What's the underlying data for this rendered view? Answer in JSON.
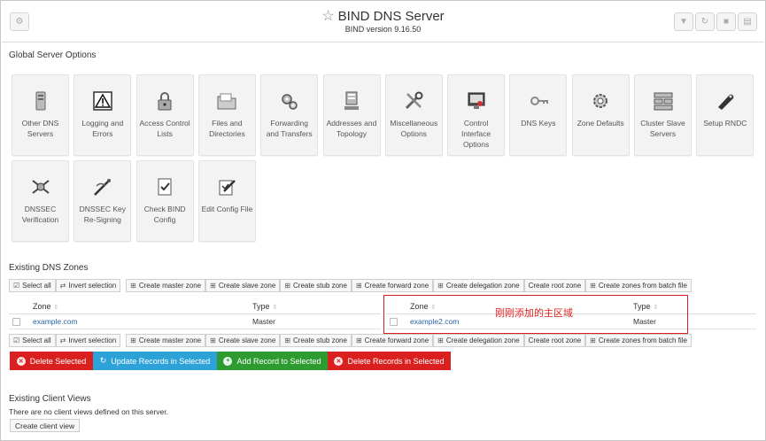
{
  "header": {
    "title": "BIND DNS Server",
    "subtitle": "BIND version 9.16.50",
    "icons": [
      "gear-icon",
      "filter-icon",
      "refresh-icon",
      "stop-icon",
      "config-icon"
    ]
  },
  "global_options": {
    "heading": "Global Server Options",
    "modules": [
      {
        "label": "Other DNS Servers",
        "icon": "server-icon"
      },
      {
        "label": "Logging and Errors",
        "icon": "warning-icon"
      },
      {
        "label": "Access Control Lists",
        "icon": "lock-icon"
      },
      {
        "label": "Files and Directories",
        "icon": "folder-icon"
      },
      {
        "label": "Forwarding and Transfers",
        "icon": "gears-icon"
      },
      {
        "label": "Addresses and Topology",
        "icon": "computer-icon"
      },
      {
        "label": "Miscellaneous Options",
        "icon": "tools-icon"
      },
      {
        "label": "Control Interface Options",
        "icon": "monitor-icon"
      },
      {
        "label": "DNS Keys",
        "icon": "key-icon"
      },
      {
        "label": "Zone Defaults",
        "icon": "gear-icon"
      },
      {
        "label": "Cluster Slave Servers",
        "icon": "cluster-icon"
      },
      {
        "label": "Setup RNDC",
        "icon": "remote-icon"
      },
      {
        "label": "DNSSEC Verification",
        "icon": "dnssec-icon"
      },
      {
        "label": "DNSSEC Key Re-Signing",
        "icon": "signing-icon"
      },
      {
        "label": "Check BIND Config",
        "icon": "check-icon"
      },
      {
        "label": "Edit Config File",
        "icon": "edit-icon"
      }
    ]
  },
  "zones": {
    "heading": "Existing DNS Zones",
    "toolbar": [
      "Select all",
      "Invert selection",
      "Create master zone",
      "Create slave zone",
      "Create stub zone",
      "Create forward zone",
      "Create delegation zone",
      "Create root zone",
      "Create zones from batch file"
    ],
    "col_zone": "Zone",
    "col_type": "Type",
    "left": {
      "zone": "example.com",
      "type": "Master"
    },
    "right": {
      "zone": "example2.com",
      "type": "Master"
    },
    "annotation": "刚刚添加的主区域",
    "actions": {
      "delete": "Delete Selected",
      "update": "Update Records in Selected",
      "add": "Add Record to Selected",
      "delete_records": "Delete Records in Selected"
    },
    "colors": {
      "red": "#d9201f",
      "blue": "#2da2d9",
      "green": "#2d9b2f"
    }
  },
  "views": {
    "heading": "Existing Client Views",
    "message": "There are no client views defined on this server.",
    "button": "Create client view"
  }
}
